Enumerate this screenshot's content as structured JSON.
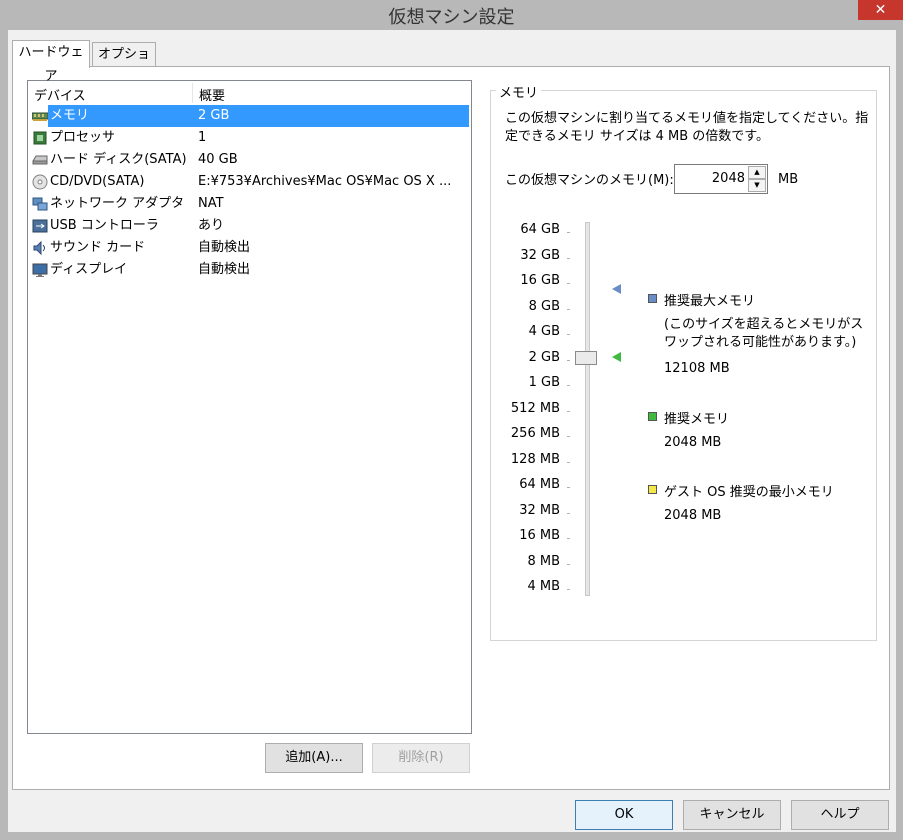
{
  "window": {
    "title": "仮想マシン設定",
    "close_glyph": "✕"
  },
  "tabs": [
    {
      "label": "ハードウェア",
      "active": true
    },
    {
      "label": "オプション",
      "active": false
    }
  ],
  "device_list": {
    "columns": [
      "デバイス",
      "概要"
    ],
    "rows": [
      {
        "icon": "memory-icon",
        "device": "メモリ",
        "summary": "2 GB",
        "selected": true
      },
      {
        "icon": "processor-icon",
        "device": "プロセッサ",
        "summary": "1"
      },
      {
        "icon": "hard-disk-icon",
        "device": "ハード ディスク(SATA)",
        "summary": "40 GB"
      },
      {
        "icon": "cd-dvd-icon",
        "device": "CD/DVD(SATA)",
        "summary": "E:¥753¥Archives¥Mac OS¥Mac OS X ..."
      },
      {
        "icon": "network-adapter-icon",
        "device": "ネットワーク アダプタ",
        "summary": "NAT"
      },
      {
        "icon": "usb-icon",
        "device": "USB コントローラ",
        "summary": "あり"
      },
      {
        "icon": "sound-card-icon",
        "device": "サウンド カード",
        "summary": "自動検出"
      },
      {
        "icon": "display-icon",
        "device": "ディスプレイ",
        "summary": "自動検出"
      }
    ]
  },
  "buttons": {
    "add": "追加(A)...",
    "remove": "削除(R)",
    "ok": "OK",
    "cancel": "キャンセル",
    "help": "ヘルプ"
  },
  "memory": {
    "group_title": "メモリ",
    "description": "この仮想マシンに割り当てるメモリ値を指定してください。指定できるメモリ サイズは 4 MB の倍数です。",
    "field_label": "この仮想マシンのメモリ(M):",
    "value": "2048",
    "unit": "MB",
    "scale": [
      "64 GB",
      "32 GB",
      "16 GB",
      "8 GB",
      "4 GB",
      "2 GB",
      "1 GB",
      "512 MB",
      "256 MB",
      "128 MB",
      "64 MB",
      "32 MB",
      "16 MB",
      "8 MB",
      "4 MB"
    ],
    "slider_value": "2 GB",
    "legend": {
      "max": {
        "label": "推奨最大メモリ",
        "note": "(このサイズを超えるとメモリがスワップされる可能性があります。)",
        "value": "12108 MB",
        "color": "#6a8cc7"
      },
      "recommended": {
        "label": "推奨メモリ",
        "value": "2048 MB",
        "color": "#3fb93f"
      },
      "min": {
        "label": "ゲスト OS 推奨の最小メモリ",
        "value": "2048 MB",
        "color": "#f2e84a"
      }
    }
  }
}
